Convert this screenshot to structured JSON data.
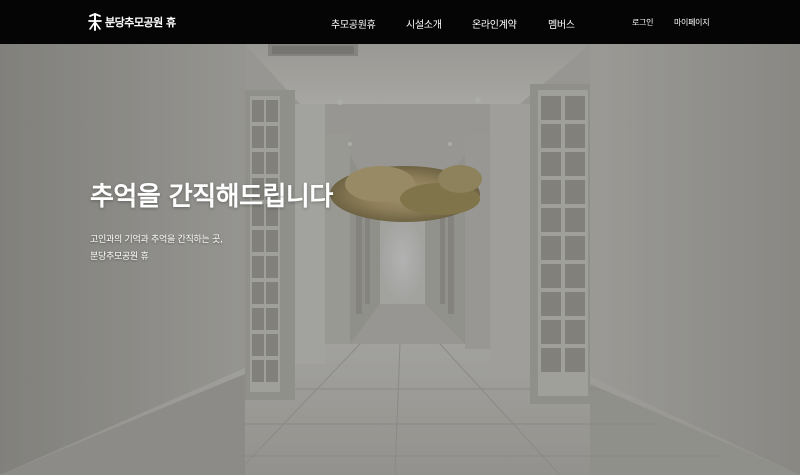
{
  "header": {
    "logo": {
      "symbol": "休",
      "text": "분당추모공원 휴"
    },
    "nav": [
      {
        "label": "추모공원휴"
      },
      {
        "label": "시설소개"
      },
      {
        "label": "온라인계약"
      },
      {
        "label": "멤버스"
      }
    ],
    "util": {
      "login": "로그인",
      "mypage": "마이페이지"
    }
  },
  "hero": {
    "title": "추억을 간직해드립니다",
    "desc_line1": "고인과의 기억과 추억을 간직하는 곳,",
    "desc_line2": "분당추모공원 휴"
  },
  "colors": {
    "header_bg": "#050505",
    "wall": "#d9d8d2",
    "floor": "#cfcec8",
    "flower_accent": "#c8b27a"
  }
}
